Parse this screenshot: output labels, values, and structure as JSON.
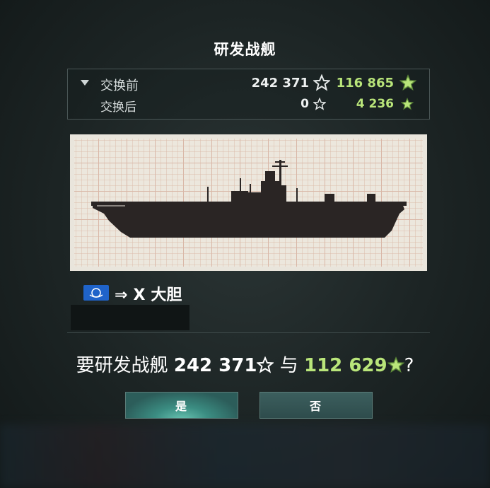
{
  "dialog": {
    "title": "研发战舰",
    "exchange": {
      "before": {
        "label": "交换前",
        "xp": "242 371",
        "free_xp": "116 865"
      },
      "after": {
        "label": "交换后",
        "xp": "0",
        "free_xp": "4 236"
      }
    },
    "ship": {
      "tier": "X",
      "name": "大胆",
      "nation_icon": "nation-flag-icon",
      "arrow": "⇒"
    },
    "question": {
      "prefix": "要研发战舰",
      "xp": "242 371",
      "joiner": "与",
      "free_xp": "112 629",
      "suffix": "?"
    },
    "buttons": {
      "yes": "是",
      "no": "否"
    }
  },
  "colors": {
    "free_xp": "#b9e57a",
    "button_teal": "#3b8d82",
    "flag_blue": "#1f63c9"
  }
}
